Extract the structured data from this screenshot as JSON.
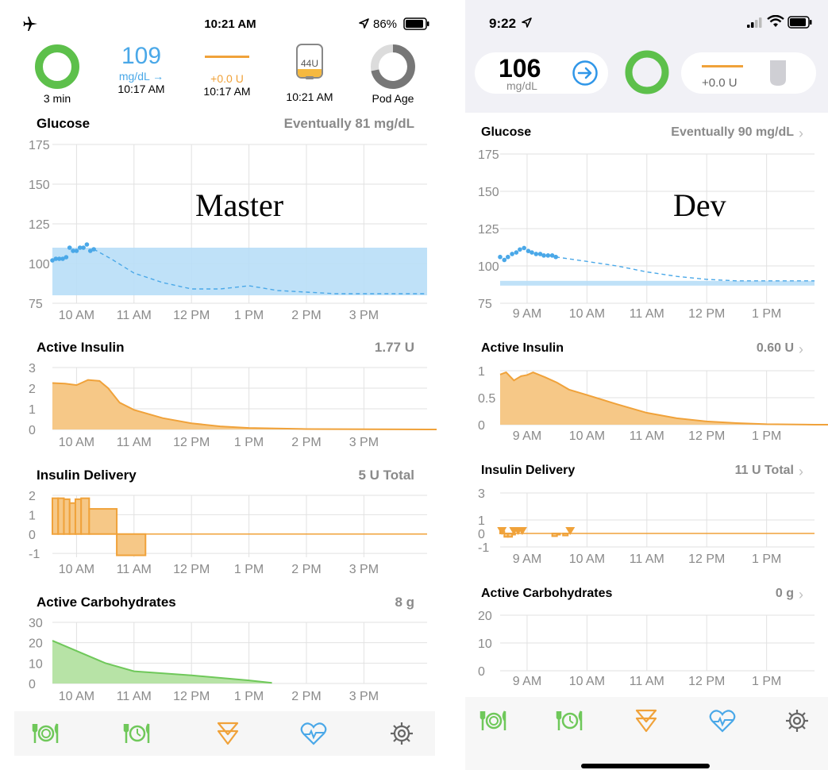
{
  "master": {
    "label": "Master",
    "status": {
      "time": "10:21 AM",
      "battery": "86%"
    },
    "header": {
      "loop_label": "3 min",
      "glucose_value": "109",
      "glucose_unit": "mg/dL →",
      "glucose_time": "10:17 AM",
      "temp_basal": "+0.0 U",
      "temp_basal_time": "10:17 AM",
      "reservoir": "44U",
      "reservoir_time": "10:21 AM",
      "pod_age": "Pod Age"
    },
    "sections": {
      "glucose": {
        "title": "Glucose",
        "value": "Eventually 81 mg/dL"
      },
      "insulin": {
        "title": "Active Insulin",
        "value": "1.77 U"
      },
      "delivery": {
        "title": "Insulin Delivery",
        "value": "5 U Total"
      },
      "carbs": {
        "title": "Active Carbohydrates",
        "value": "8 g"
      }
    },
    "x_ticks": [
      "10 AM",
      "11 AM",
      "12 PM",
      "1 PM",
      "2 PM",
      "3 PM"
    ],
    "y_ticks": {
      "glucose": [
        "175",
        "150",
        "125",
        "100",
        "75"
      ],
      "insulin": [
        "3",
        "2",
        "1",
        "0"
      ],
      "delivery": [
        "2",
        "1",
        "0",
        "-1"
      ],
      "carbs": [
        "30",
        "20",
        "10",
        "0"
      ]
    }
  },
  "dev": {
    "label": "Dev",
    "status": {
      "time": "9:22"
    },
    "header": {
      "glucose_value": "106",
      "glucose_unit": "mg/dL",
      "temp_basal": "+0.0 U"
    },
    "sections": {
      "glucose": {
        "title": "Glucose",
        "value": "Eventually 90 mg/dL"
      },
      "insulin": {
        "title": "Active Insulin",
        "value": "0.60 U"
      },
      "delivery": {
        "title": "Insulin Delivery",
        "value": "11 U Total"
      },
      "carbs": {
        "title": "Active Carbohydrates",
        "value": "0 g"
      }
    },
    "x_ticks": [
      "9 AM",
      "10 AM",
      "11 AM",
      "12 PM",
      "1 PM"
    ],
    "y_ticks": {
      "glucose": [
        "175",
        "150",
        "125",
        "100",
        "75"
      ],
      "insulin": [
        "1",
        "0.5",
        "0"
      ],
      "delivery": [
        "3",
        "1",
        "0",
        "-1"
      ],
      "carbs": [
        "20",
        "10",
        "0"
      ]
    }
  },
  "tabbar": {
    "icons": [
      "carb-entry-icon",
      "pre-meal-icon",
      "bolus-icon",
      "workout-icon",
      "settings-icon"
    ]
  },
  "colors": {
    "glucose": "#4aa8e8",
    "target": "#b8def7",
    "insulin": "#f0a23a",
    "insulin_fill": "#f6c887",
    "carbs": "#6fc85a",
    "carbs_fill": "#b7e3a6",
    "loop_ring": "#5dc04b",
    "grid": "#e2e2e2"
  },
  "chart_data": [
    {
      "panel": "master",
      "chart": "glucose",
      "type": "scatter",
      "ylim": [
        75,
        175
      ],
      "target_range": [
        80,
        110
      ],
      "points": [
        [
          9.58,
          102
        ],
        [
          9.64,
          103
        ],
        [
          9.7,
          103
        ],
        [
          9.76,
          103
        ],
        [
          9.82,
          104
        ],
        [
          9.88,
          110
        ],
        [
          9.94,
          108
        ],
        [
          10.0,
          108
        ],
        [
          10.06,
          110
        ],
        [
          10.12,
          110
        ],
        [
          10.18,
          112
        ],
        [
          10.24,
          108
        ],
        [
          10.3,
          109
        ]
      ],
      "forecast": [
        [
          10.3,
          109
        ],
        [
          10.6,
          103
        ],
        [
          11.0,
          94
        ],
        [
          11.5,
          88
        ],
        [
          12.0,
          84
        ],
        [
          12.5,
          84
        ],
        [
          13.0,
          86
        ],
        [
          13.5,
          83
        ],
        [
          14.0,
          82
        ],
        [
          14.5,
          81
        ],
        [
          15.0,
          81
        ],
        [
          15.5,
          81
        ],
        [
          16.1,
          81
        ]
      ]
    },
    {
      "panel": "master",
      "chart": "active_insulin",
      "type": "area",
      "ylim": [
        0,
        3
      ],
      "points": [
        [
          9.58,
          2.25
        ],
        [
          9.8,
          2.22
        ],
        [
          10.0,
          2.15
        ],
        [
          10.2,
          2.4
        ],
        [
          10.4,
          2.35
        ],
        [
          10.55,
          2.0
        ],
        [
          10.75,
          1.3
        ],
        [
          11.0,
          0.95
        ],
        [
          11.5,
          0.55
        ],
        [
          12.0,
          0.3
        ],
        [
          12.5,
          0.15
        ],
        [
          13.0,
          0.07
        ],
        [
          14.0,
          0.02
        ],
        [
          16.1,
          0.0
        ]
      ]
    },
    {
      "panel": "master",
      "chart": "insulin_delivery",
      "type": "bar",
      "ylim": [
        -1.2,
        2
      ],
      "bars": [
        [
          9.58,
          9.68,
          1.85
        ],
        [
          9.68,
          9.78,
          1.85
        ],
        [
          9.78,
          9.88,
          1.8
        ],
        [
          9.88,
          9.98,
          1.6
        ],
        [
          9.98,
          10.08,
          1.8
        ],
        [
          10.08,
          10.22,
          1.85
        ],
        [
          10.22,
          10.7,
          1.3
        ],
        [
          10.7,
          11.2,
          -1.1
        ]
      ],
      "baseline_end": 16.1
    },
    {
      "panel": "master",
      "chart": "active_carbs",
      "type": "area",
      "ylim": [
        0,
        30
      ],
      "points": [
        [
          9.58,
          21
        ],
        [
          10.5,
          10
        ],
        [
          11.0,
          6
        ],
        [
          12.0,
          4
        ],
        [
          13.0,
          1.5
        ],
        [
          13.4,
          0.3
        ]
      ]
    },
    {
      "panel": "dev",
      "chart": "glucose",
      "type": "scatter",
      "ylim": [
        75,
        175
      ],
      "target_range": [
        88,
        90
      ],
      "points": [
        [
          8.55,
          106
        ],
        [
          8.62,
          104
        ],
        [
          8.68,
          106
        ],
        [
          8.75,
          108
        ],
        [
          8.82,
          109
        ],
        [
          8.88,
          111
        ],
        [
          8.95,
          112
        ],
        [
          9.02,
          110
        ],
        [
          9.08,
          109
        ],
        [
          9.15,
          108
        ],
        [
          9.22,
          108
        ],
        [
          9.28,
          107
        ],
        [
          9.35,
          107
        ],
        [
          9.42,
          107
        ],
        [
          9.48,
          106
        ]
      ],
      "forecast": [
        [
          9.48,
          106
        ],
        [
          10.0,
          103
        ],
        [
          10.5,
          100
        ],
        [
          11.0,
          96
        ],
        [
          11.5,
          93
        ],
        [
          12.0,
          91
        ],
        [
          12.5,
          90
        ],
        [
          13.0,
          90
        ],
        [
          13.5,
          90
        ],
        [
          13.8,
          90
        ]
      ]
    },
    {
      "panel": "dev",
      "chart": "active_insulin",
      "type": "area",
      "ylim": [
        0,
        1
      ],
      "points": [
        [
          8.55,
          0.93
        ],
        [
          8.65,
          0.97
        ],
        [
          8.78,
          0.82
        ],
        [
          8.9,
          0.9
        ],
        [
          9.0,
          0.92
        ],
        [
          9.1,
          0.97
        ],
        [
          9.3,
          0.88
        ],
        [
          9.5,
          0.78
        ],
        [
          9.7,
          0.65
        ],
        [
          9.85,
          0.6
        ],
        [
          10.0,
          0.55
        ],
        [
          10.5,
          0.38
        ],
        [
          11.0,
          0.22
        ],
        [
          11.5,
          0.12
        ],
        [
          12.0,
          0.06
        ],
        [
          12.5,
          0.03
        ],
        [
          13.0,
          0.01
        ],
        [
          13.8,
          0.0
        ]
      ]
    },
    {
      "panel": "dev",
      "chart": "insulin_delivery",
      "type": "bar",
      "ylim": [
        -1,
        3
      ],
      "bars": [
        [
          8.55,
          8.62,
          0.15
        ],
        [
          8.62,
          8.68,
          -0.25
        ],
        [
          8.68,
          8.75,
          -0.25
        ],
        [
          8.75,
          8.8,
          0.0
        ],
        [
          9.42,
          9.5,
          -0.2
        ],
        [
          9.5,
          9.55,
          0.0
        ],
        [
          9.6,
          9.68,
          -0.15
        ]
      ],
      "bolus_markers": [
        8.58,
        8.78,
        8.85,
        8.92,
        9.72
      ],
      "baseline_end": 13.8
    },
    {
      "panel": "dev",
      "chart": "active_carbs",
      "type": "area",
      "ylim": [
        0,
        20
      ],
      "points": []
    }
  ]
}
